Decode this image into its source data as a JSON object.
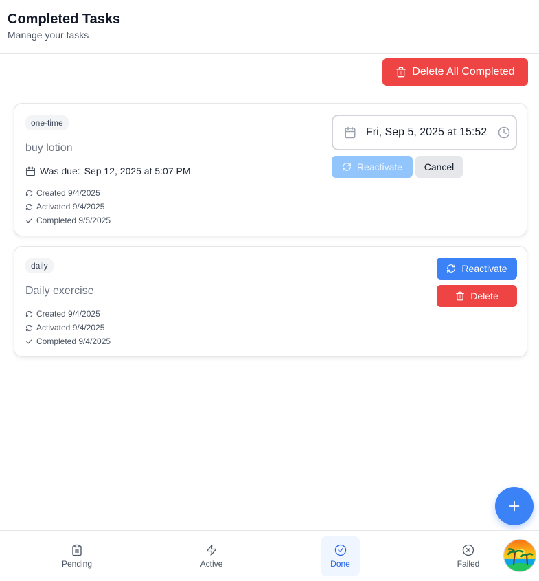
{
  "header": {
    "title": "Completed Tasks",
    "subtitle": "Manage your tasks"
  },
  "actions": {
    "delete_all_label": "Delete All Completed"
  },
  "tasks": [
    {
      "type": "one-time",
      "title": "buy lotion",
      "due_label": "Was due:",
      "due_value": "Sep 12, 2025 at 5:07 PM",
      "created": "Created 9/4/2025",
      "activated": "Activated 9/4/2025",
      "completed": "Completed 9/5/2025",
      "date_input_value": "Fri, Sep 5, 2025 at 15:52",
      "reactivate_label": "Reactivate",
      "cancel_label": "Cancel"
    },
    {
      "type": "daily",
      "title": "Daily exercise",
      "created": "Created 9/4/2025",
      "activated": "Activated 9/4/2025",
      "completed": "Completed 9/4/2025",
      "reactivate_label": "Reactivate",
      "delete_label": "Delete"
    }
  ],
  "nav": {
    "pending": "Pending",
    "active": "Active",
    "done": "Done",
    "failed": "Failed"
  },
  "colors": {
    "primary": "#3b82f6",
    "danger": "#ef4444",
    "primary_disabled": "#93c5fd"
  }
}
